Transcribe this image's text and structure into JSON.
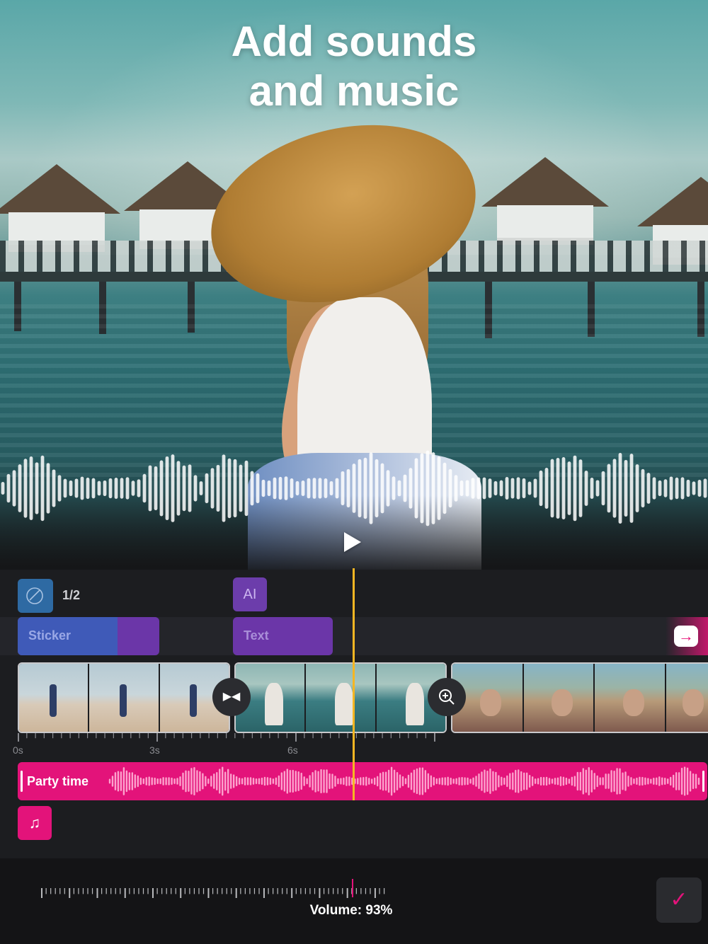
{
  "headline": {
    "line1": "Add sounds",
    "line2": "and music"
  },
  "overlay_tracks": {
    "sticker_count": "1/2",
    "sticker_label": "Sticker",
    "text_label": "Text",
    "text_icon": "AI"
  },
  "ruler": {
    "labels": [
      "0s",
      "3s",
      "6s"
    ]
  },
  "audio": {
    "track_label": "Party time"
  },
  "volume": {
    "label": "Volume: 93%",
    "value_percent": 93
  },
  "icons": {
    "play": "play-icon",
    "sticker": "sticker-icon",
    "text": "text-cursor-icon",
    "arrow": "arrow-right-icon",
    "transition": "transition-icon",
    "zoom": "zoom-in-icon",
    "music": "music-note-icon",
    "confirm": "checkmark-icon"
  },
  "colors": {
    "accent": "#e3137a",
    "playhead": "#f5b623",
    "sticker": "#3f5ab8",
    "text_clip": "#6b36a8"
  }
}
